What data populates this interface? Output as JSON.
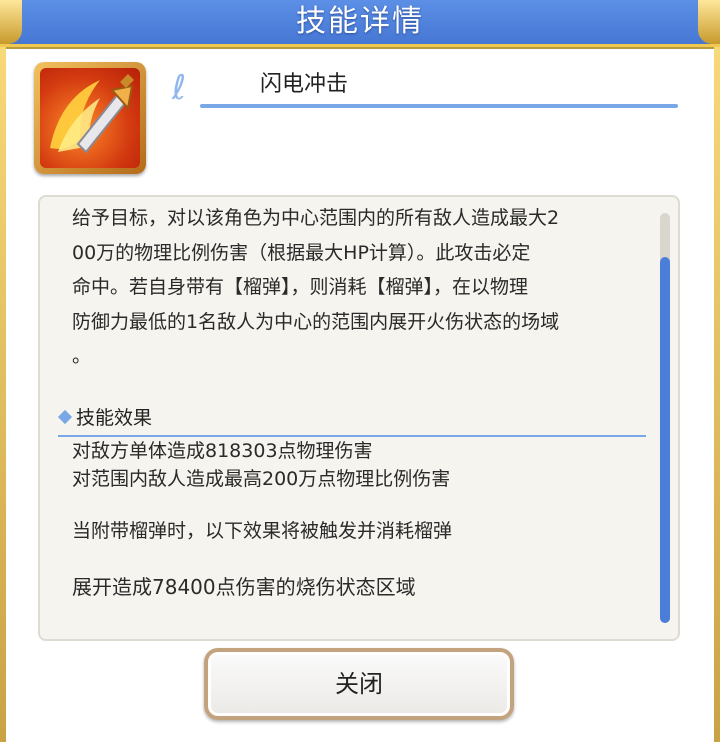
{
  "dialog": {
    "title": "技能详情",
    "close_label": "关闭"
  },
  "skill": {
    "name": "闪电冲击",
    "icon": "flaming-sword-icon",
    "description_lines": [
      "给予目标，对以该角色为中心范围内的所有敌人造成最大2",
      "00万的物理比例伤害（根据最大HP计算）。此攻击必定",
      "命中。若自身带有【榴弹】，则消耗【榴弹】，在以物理",
      "防御力最低的1名敌人为中心的范围内展开火伤状态的场域",
      "。"
    ],
    "effects_header": "技能效果",
    "effects": [
      "对敌方单体造成818303点物理伤害",
      "对范围内敌人造成最高200万点物理比例伤害",
      "当附带榴弹时，以下效果将被触发并消耗榴弹",
      "展开造成78400点伤害的烧伤状态区域"
    ]
  },
  "colors": {
    "header_blue": "#4f80db",
    "accent_blue": "#7aa8e6",
    "gold_border": "#f0c94e",
    "scroll_thumb": "#4a7ed8"
  }
}
